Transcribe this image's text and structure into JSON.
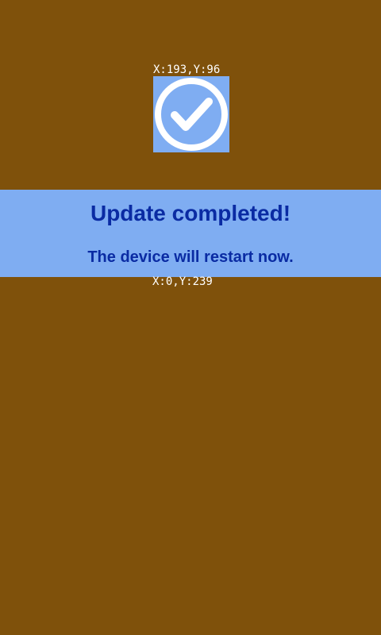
{
  "overlay": {
    "icon_coord_label": "X:193,Y:96",
    "banner_coord_label": "X:0,Y:239"
  },
  "status": {
    "icon": "checkmark-circle-icon",
    "title": "Update completed!",
    "message": "The device will restart now."
  },
  "colors": {
    "background": "#7f510b",
    "accent": "#7fadf2",
    "text": "#0a2ba3",
    "icon": "#ffffff"
  }
}
